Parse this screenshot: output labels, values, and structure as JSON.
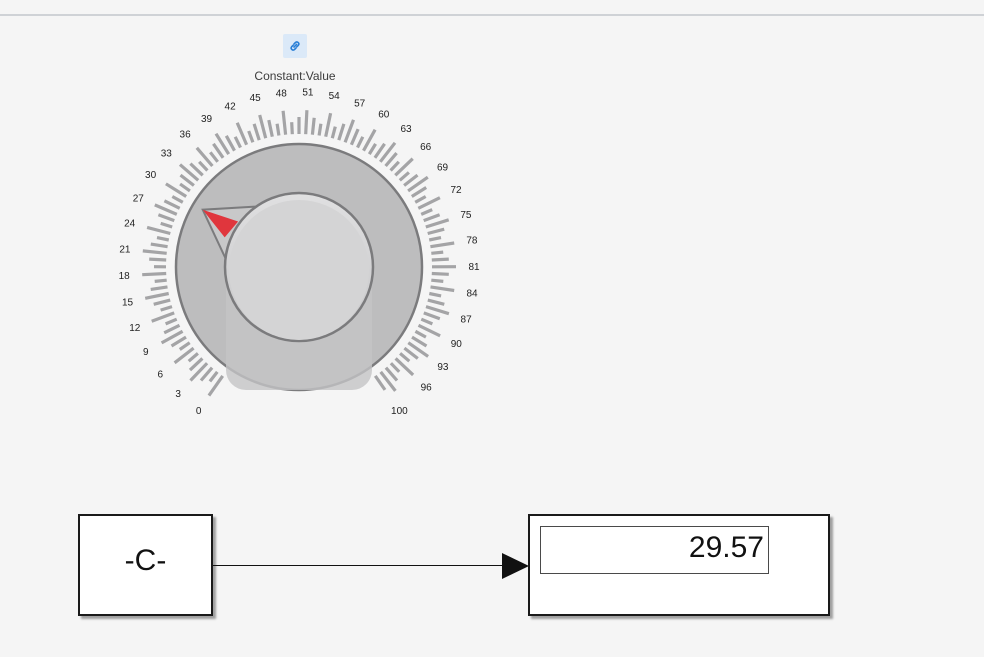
{
  "dial": {
    "title": "Constant:Value",
    "min": 0,
    "max": 100,
    "value": 29.57,
    "tick_labels": [
      "0",
      "3",
      "6",
      "9",
      "12",
      "15",
      "18",
      "21",
      "24",
      "27",
      "30",
      "33",
      "36",
      "39",
      "42",
      "45",
      "48",
      "51",
      "54",
      "57",
      "60",
      "63",
      "66",
      "69",
      "72",
      "75",
      "78",
      "81",
      "84",
      "87",
      "90",
      "93",
      "96",
      "100"
    ],
    "pointer_color": "#e0363d",
    "link_icon": "link-icon"
  },
  "constant_block": {
    "label": "-C-"
  },
  "display_block": {
    "value": "29.57"
  }
}
